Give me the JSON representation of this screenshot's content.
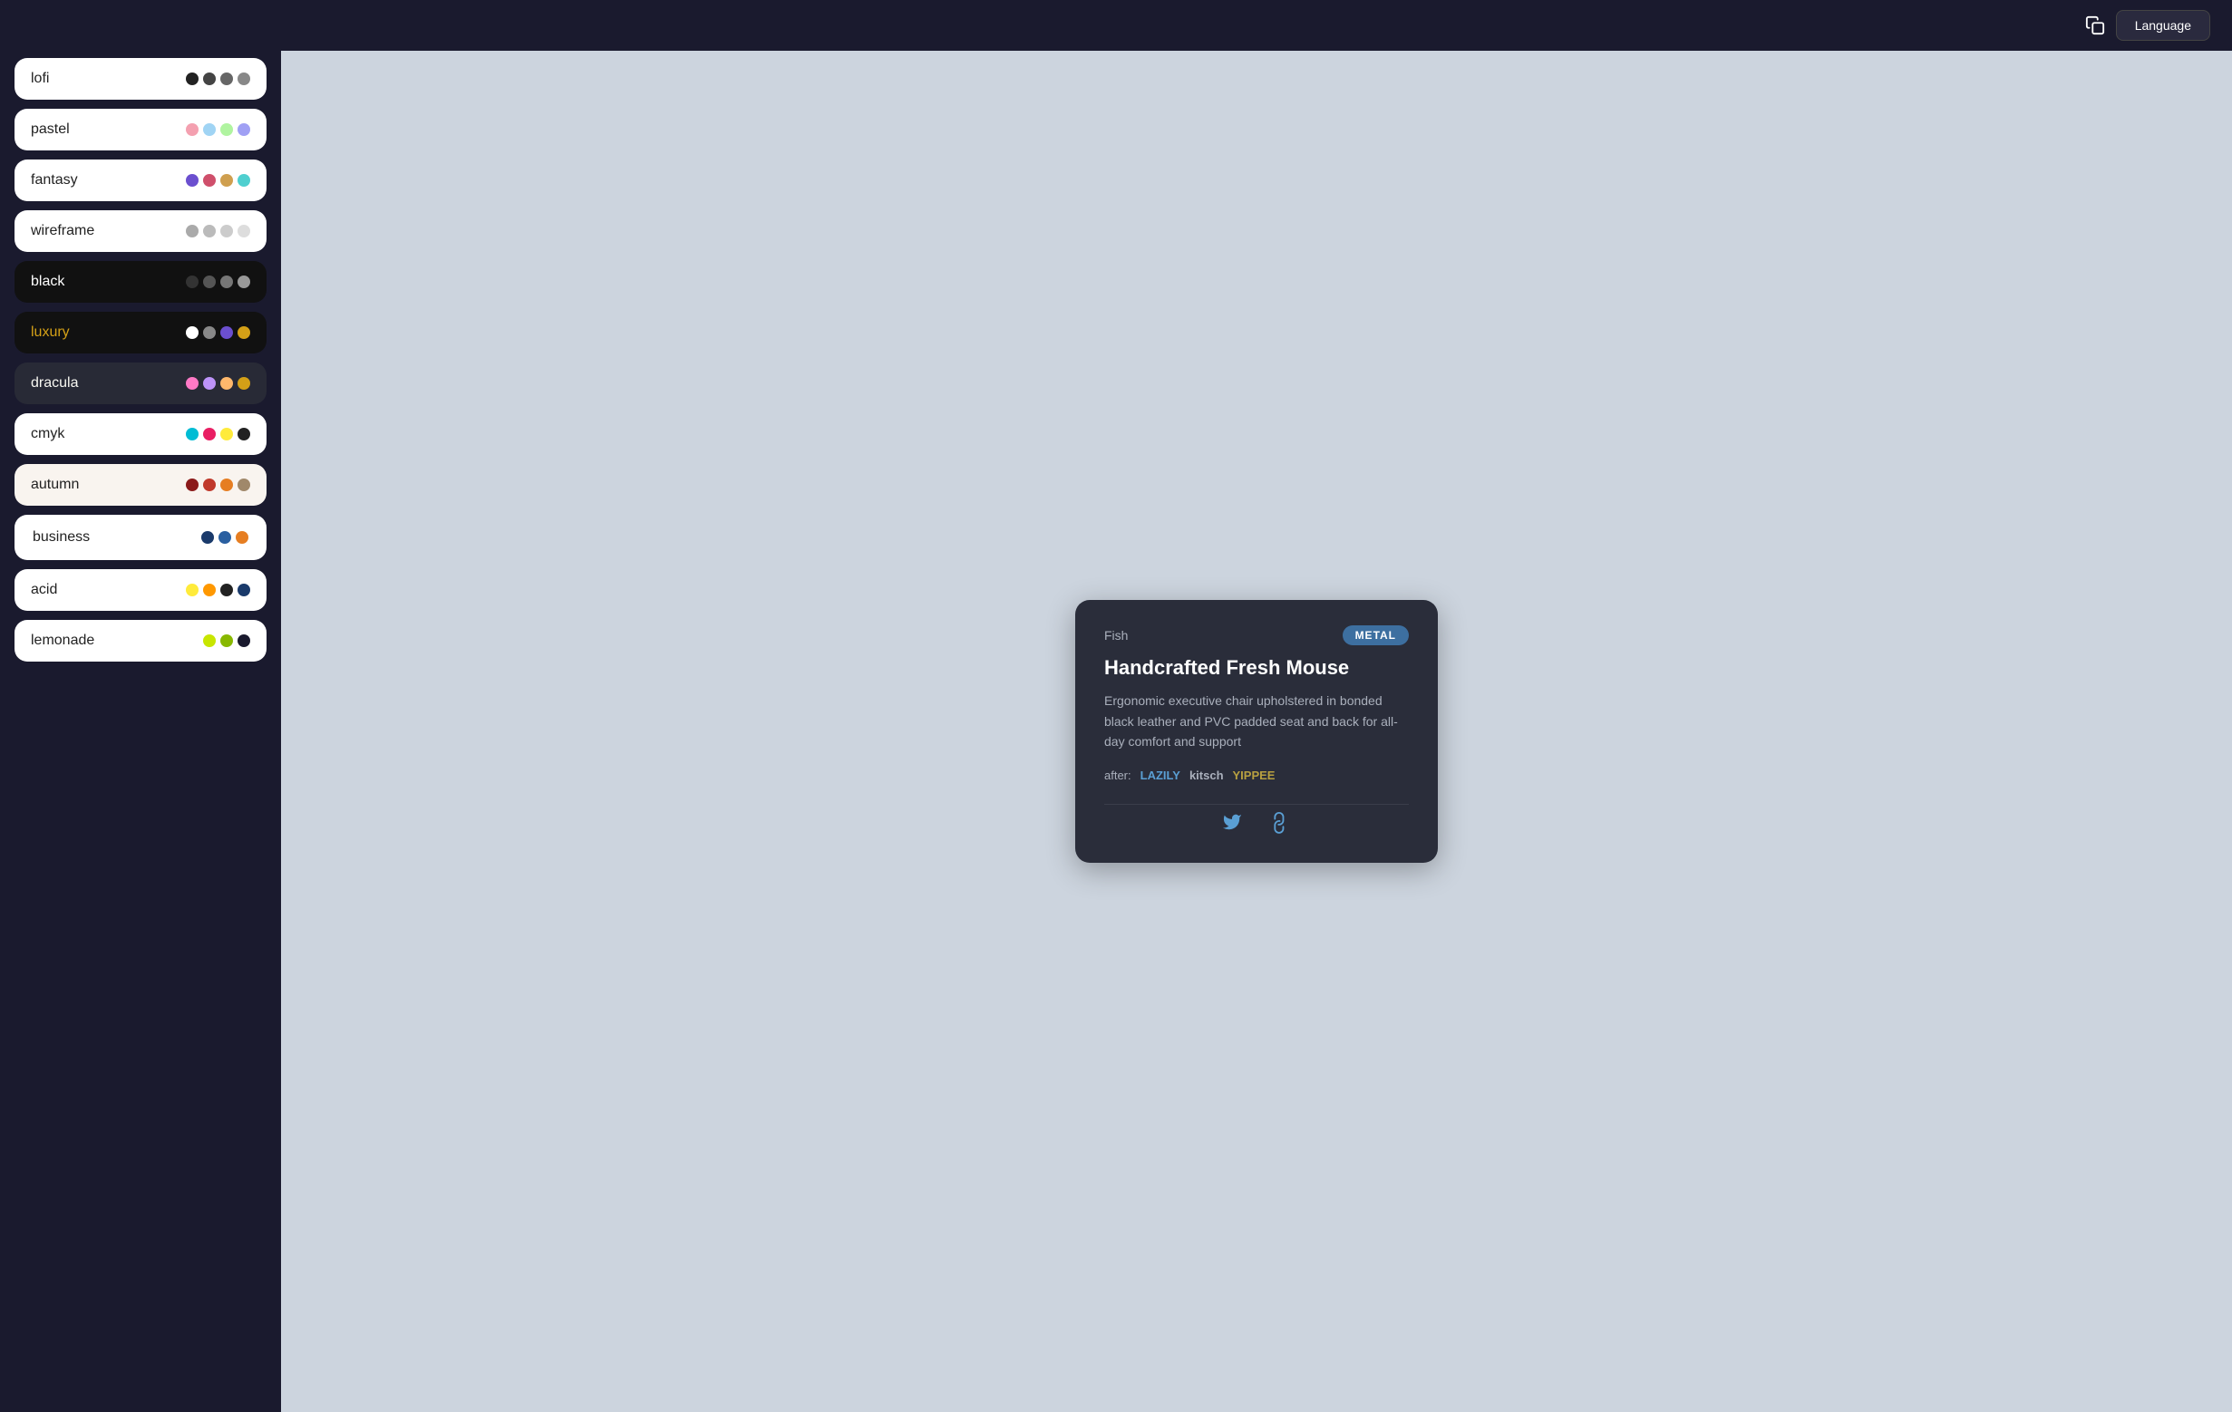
{
  "topnav": {
    "language_label": "Language"
  },
  "sidebar": {
    "themes": [
      {
        "id": "lofi",
        "label": "lofi",
        "bg_class": "theme-lofi",
        "dots": [
          "#222",
          "#444",
          "#666",
          "#888"
        ],
        "selected": false
      },
      {
        "id": "pastel",
        "label": "pastel",
        "bg_class": "theme-pastel",
        "dots": [
          "#f4a0b0",
          "#a0d4f4",
          "#b0f4a0",
          "#a0a0f4"
        ],
        "selected": false
      },
      {
        "id": "fantasy",
        "label": "fantasy",
        "bg_class": "theme-fantasy",
        "dots": [
          "#6b4fcf",
          "#cf4f6b",
          "#cf9f4f",
          "#4fcfcf"
        ],
        "selected": false
      },
      {
        "id": "wireframe",
        "label": "wireframe",
        "bg_class": "theme-wireframe",
        "dots": [
          "#aaa",
          "#bbb",
          "#ccc",
          "#ddd"
        ],
        "selected": false
      },
      {
        "id": "black",
        "label": "black",
        "bg_class": "theme-black",
        "dots": [
          "#333",
          "#555",
          "#777",
          "#999"
        ],
        "selected": false
      },
      {
        "id": "luxury",
        "label": "luxury",
        "bg_class": "theme-luxury",
        "dots": [
          "#fff",
          "#888",
          "#6b4fcf",
          "#d4a017"
        ],
        "selected": false
      },
      {
        "id": "dracula",
        "label": "dracula",
        "bg_class": "theme-dracula",
        "dots": [
          "#ff79c6",
          "#bd93f9",
          "#ffb86c",
          "#d4a017"
        ],
        "selected": false
      },
      {
        "id": "cmyk",
        "label": "cmyk",
        "bg_class": "theme-cmyk",
        "dots": [
          "#00bcd4",
          "#e91e63",
          "#ffeb3b",
          "#222"
        ],
        "selected": false
      },
      {
        "id": "autumn",
        "label": "autumn",
        "bg_class": "theme-autumn",
        "dots": [
          "#8b1a1a",
          "#c0392b",
          "#e67e22",
          "#a0886a"
        ],
        "selected": false
      },
      {
        "id": "business",
        "label": "business",
        "bg_class": "theme-business",
        "dots": [
          "#1a3a6b",
          "#2a5fa0",
          "#e67e22"
        ],
        "selected": true
      },
      {
        "id": "acid",
        "label": "acid",
        "bg_class": "theme-acid",
        "dots": [
          "#ffeb3b",
          "#ff9800",
          "#222",
          "#1a3a6b"
        ],
        "selected": false
      },
      {
        "id": "lemonade",
        "label": "lemonade",
        "bg_class": "theme-lemonade",
        "dots": [
          "#c8e600",
          "#88b800",
          "#1a1a2e"
        ],
        "selected": false
      }
    ]
  },
  "card": {
    "category": "Fish",
    "badge": "METAL",
    "title": "Handcrafted Fresh Mouse",
    "description": "Ergonomic executive chair upholstered in bonded black leather and PVC padded seat and back for all-day comfort and support",
    "tags_label": "after:",
    "tags": [
      {
        "text": "LAZILY",
        "color": "blue"
      },
      {
        "text": "kitsch",
        "color": "normal"
      },
      {
        "text": "YIPPEE",
        "color": "blue"
      }
    ]
  }
}
